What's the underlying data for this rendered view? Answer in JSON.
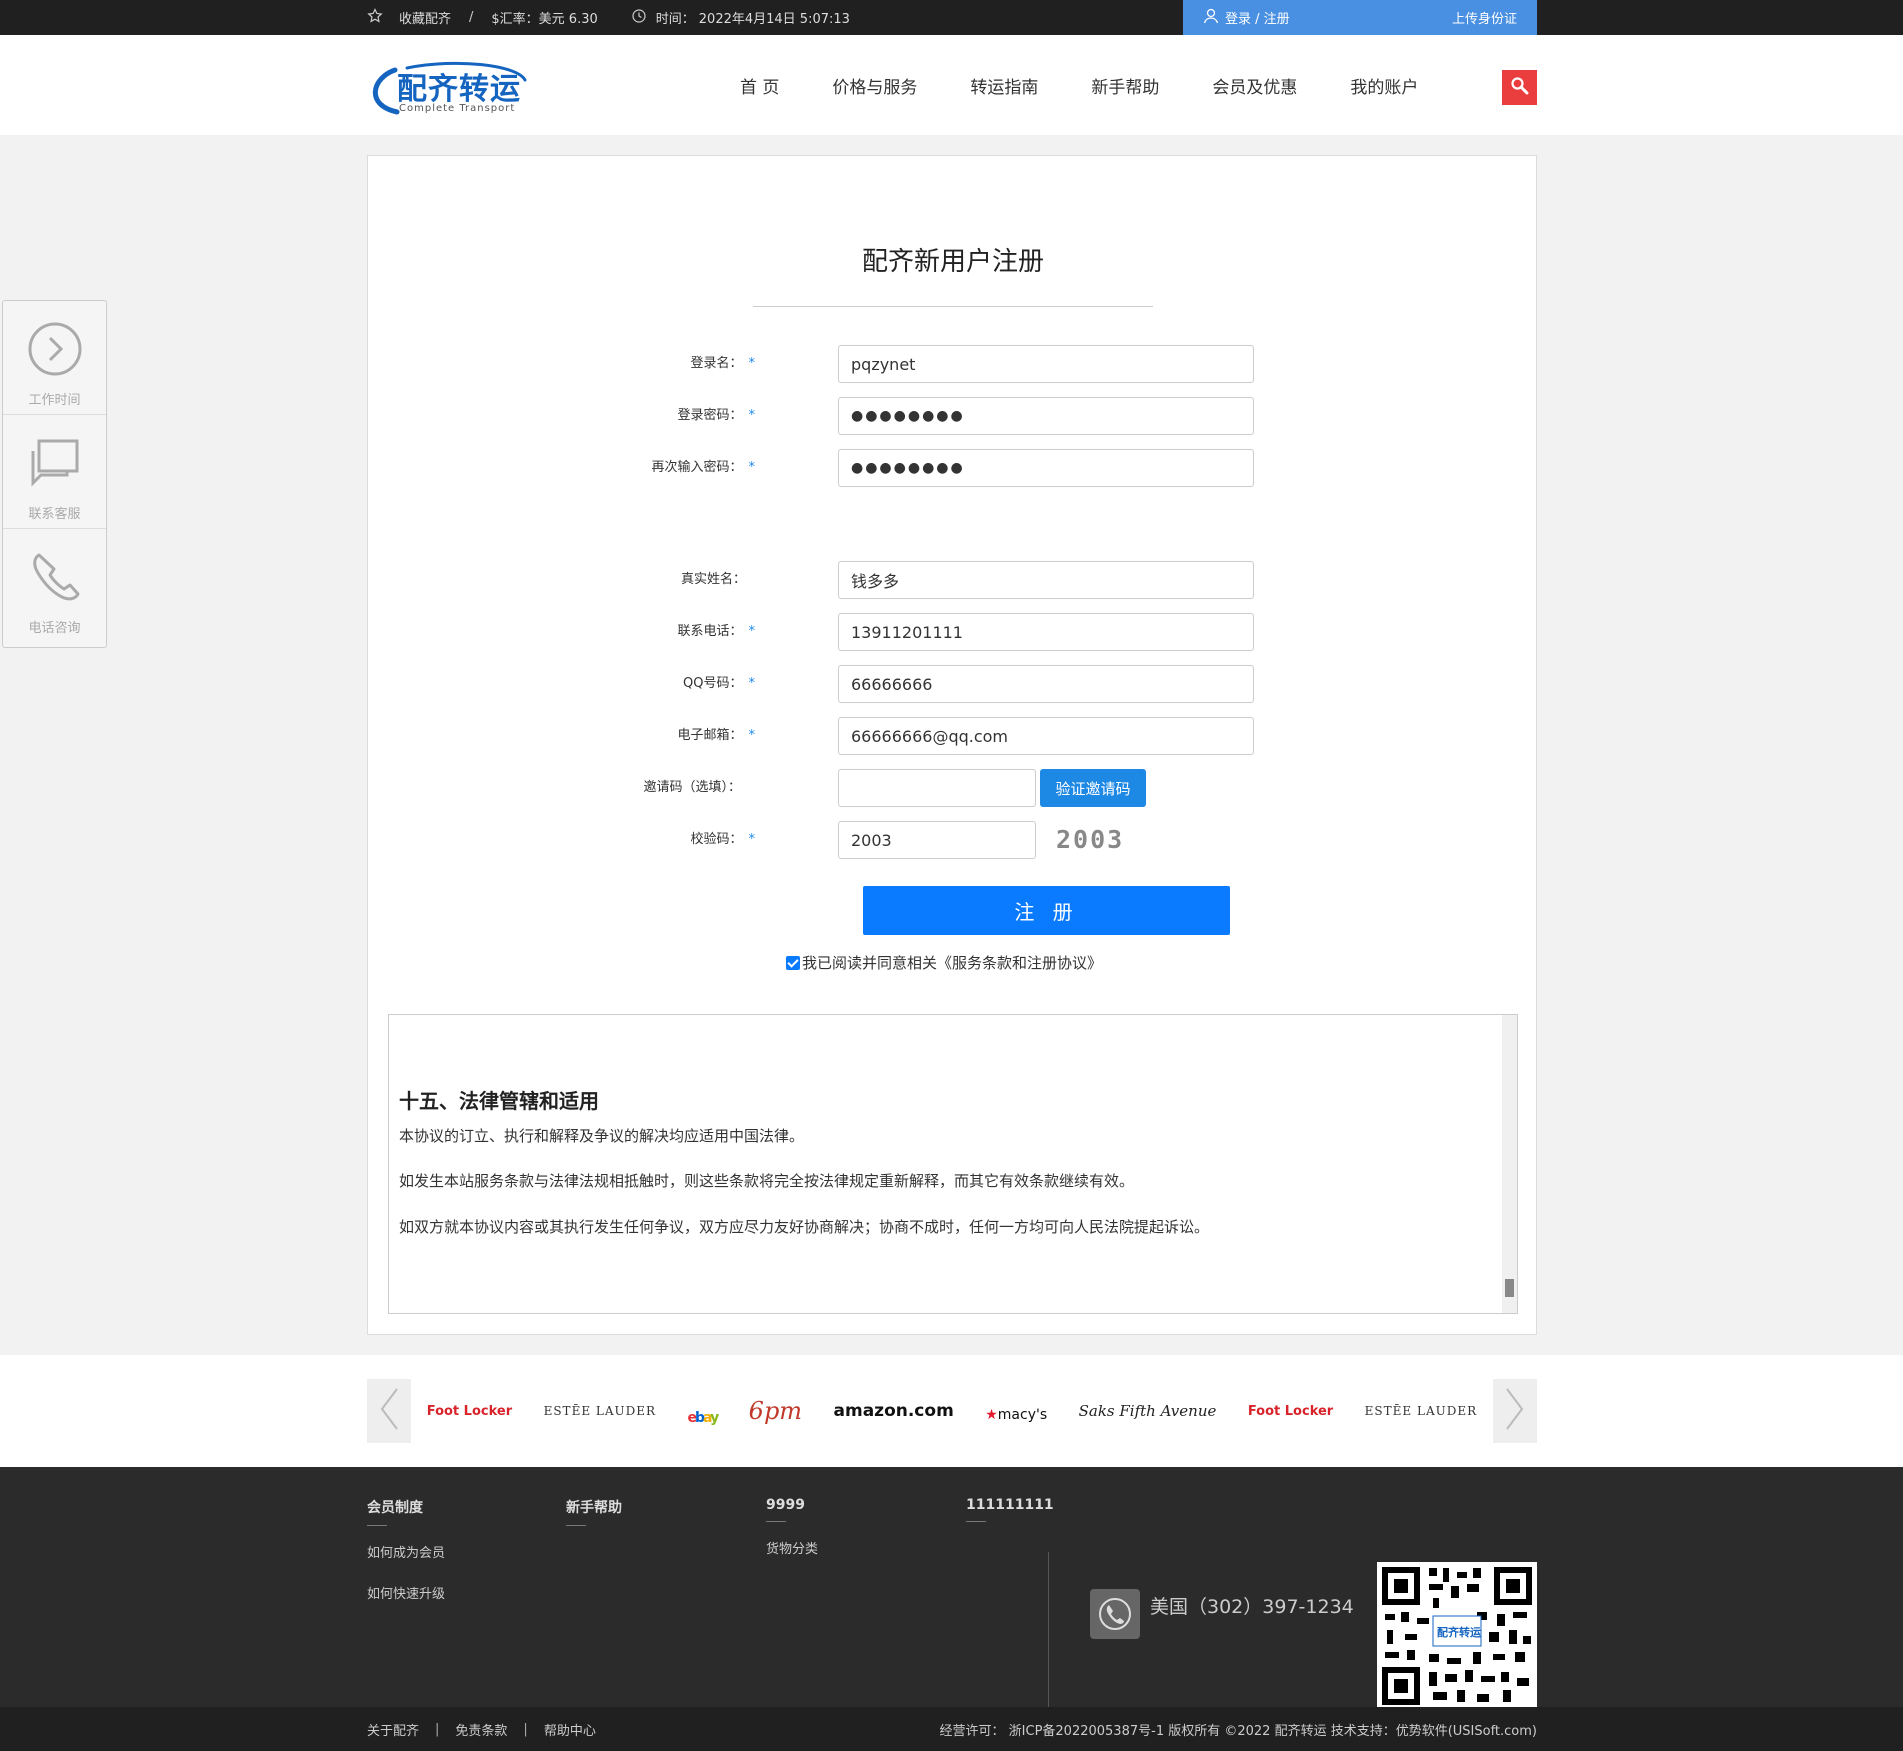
{
  "topbar": {
    "favorite": "收藏配齐",
    "separator": "/",
    "rate": "$汇率：美元 6.30",
    "time_label": "时间：",
    "time_value": "2022年4月14日 5:07:13",
    "login": "登录 / 注册",
    "upload_id": "上传身份证"
  },
  "header": {
    "logo_cn": "配齐转运",
    "logo_en": "Complete Transport",
    "nav": [
      "首 页",
      "价格与服务",
      "转运指南",
      "新手帮助",
      "会员及优惠",
      "我的账户"
    ]
  },
  "form": {
    "title": "配齐新用户注册",
    "required_mark": "*",
    "fields": [
      {
        "label": "登录名：",
        "value": "pqzynet",
        "required": true
      },
      {
        "label": "登录密码：",
        "value": "●●●●●●●●",
        "required": true
      },
      {
        "label": "再次输入密码：",
        "value": "●●●●●●●●",
        "required": true
      },
      {
        "label": "真实姓名：",
        "value": "钱多多",
        "required": false
      },
      {
        "label": "联系电话：",
        "value": "13911201111",
        "required": true
      },
      {
        "label": "QQ号码：",
        "value": "66666666",
        "required": true
      },
      {
        "label": "电子邮箱：",
        "value": "66666666@qq.com",
        "required": true
      },
      {
        "label": "邀请码（选填）：",
        "value": "",
        "required": false
      },
      {
        "label": "校验码：",
        "value": "2003",
        "required": true
      }
    ],
    "verify_button": "验证邀请码",
    "captcha_image_text": "2003",
    "submit": "注 册",
    "agree_text": "我已阅读并同意相关《服务条款和注册协议》"
  },
  "terms": {
    "heading": "十五、法律管辖和适用",
    "paragraphs": [
      "本协议的订立、执行和解释及争议的解决均应适用中国法律。",
      "如发生本站服务条款与法律法规相抵触时，则这些条款将完全按法律规定重新解释，而其它有效条款继续有效。",
      "如双方就本协议内容或其执行发生任何争议，双方应尽力友好协商解决；协商不成时，任何一方均可向人民法院提起诉讼。"
    ]
  },
  "side": {
    "items": [
      "工作时间",
      "联系客服",
      "电话咨询"
    ]
  },
  "brands": [
    "Foot Locker",
    "ESTĒE LAUDER",
    "ebay",
    "6pm",
    "amazon.com",
    "macy's",
    "Saks Fifth Avenue",
    "Foot Locker",
    "ESTĒE LAUDER"
  ],
  "footer": {
    "cols": [
      {
        "title": "会员制度",
        "links": [
          "如何成为会员",
          "如何快速升级"
        ]
      },
      {
        "title": "新手帮助",
        "links": []
      },
      {
        "title": "9999",
        "links": [
          "货物分类"
        ]
      },
      {
        "title": "111111111",
        "links": []
      }
    ],
    "phone": "美国（302）397-1234",
    "qr_text": "配齐转运"
  },
  "bottombar": {
    "links": [
      "关于配齐",
      "免责条款",
      "帮助中心"
    ],
    "sep": "|",
    "copyright": "经营许可：  浙ICP备2022005387号-1 版权所有 ©2022 配齐转运 技术支持：优势软件(USISoft.com)"
  }
}
